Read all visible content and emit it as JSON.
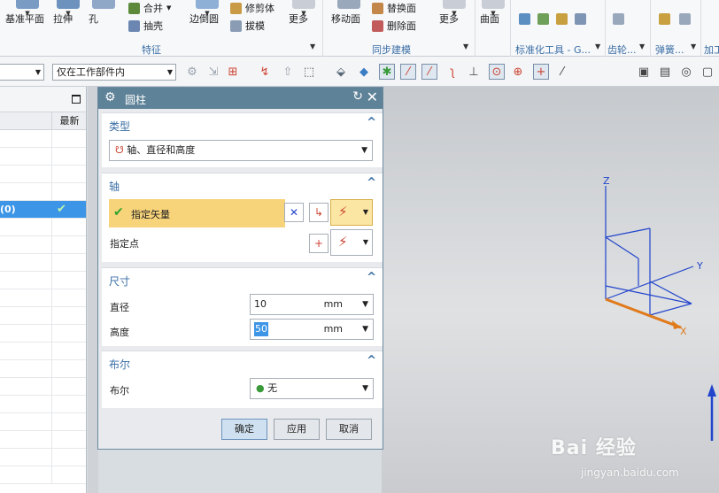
{
  "ribbon": {
    "big_buttons": [
      {
        "label": "基准平面",
        "color": "#7a9bc4"
      },
      {
        "label": "拉伸",
        "color": "#6d92be"
      },
      {
        "label": "孔",
        "color": "#8fa8c8"
      },
      {
        "label": "边倒圆",
        "color": "#8fb0d6"
      },
      {
        "label": "更多",
        "color": "#c9ced6"
      },
      {
        "label": "移动面",
        "color": "#9aa8bc"
      },
      {
        "label": "更多",
        "color": "#c9ced6"
      },
      {
        "label": "曲面",
        "color": "#c9ced6"
      }
    ],
    "small_buttons": [
      {
        "label": "合并",
        "color": "#5d8a3a"
      },
      {
        "label": "抽壳",
        "color": "#6b86b0"
      },
      {
        "label": "修剪体",
        "color": "#c89b44"
      },
      {
        "label": "拔模",
        "color": "#8a9bb4"
      },
      {
        "label": "替换面",
        "color": "#c4874a"
      },
      {
        "label": "删除面",
        "color": "#c25b5b"
      }
    ],
    "groups": [
      "特征",
      "同步建模",
      "标准化工具 - G...",
      "齿轮...",
      "弹簧...",
      "加工"
    ]
  },
  "toolbar": {
    "filter_value": "",
    "scope_value": "仅在工作部件内",
    "icons": [
      "assembly-icon",
      "snap-icon",
      "point-icon",
      "link-icon",
      "select-box-icon",
      "cube-icon",
      "body-icon",
      "faces-icon",
      "endpoint-icon",
      "midpoint-icon",
      "curve-icon",
      "intersection-icon",
      "center-icon",
      "quadrant-icon",
      "point-on-icon",
      "line-icon"
    ]
  },
  "navigator": {
    "column_latest": "最新",
    "selected_row_text": "(0)",
    "check": "✔"
  },
  "dialog": {
    "title": "圆柱",
    "sections": {
      "type": {
        "header": "类型",
        "value": "轴、直径和高度"
      },
      "axis": {
        "header": "轴",
        "specify_vector": "指定矢量",
        "specify_point": "指定点"
      },
      "size": {
        "header": "尺寸",
        "diameter_label": "直径",
        "diameter_value": "10",
        "diameter_unit": "mm",
        "height_label": "高度",
        "height_value": "50",
        "height_unit": "mm"
      },
      "boolean": {
        "header": "布尔",
        "label": "布尔",
        "value": "无"
      }
    },
    "buttons": {
      "ok": "确定",
      "apply": "应用",
      "cancel": "取消"
    }
  },
  "viewport": {
    "axis_x": "X",
    "axis_y": "Y",
    "axis_z": "Z",
    "watermark": "Bai 经验",
    "watermark_url": "jingyan.baidu.com"
  }
}
